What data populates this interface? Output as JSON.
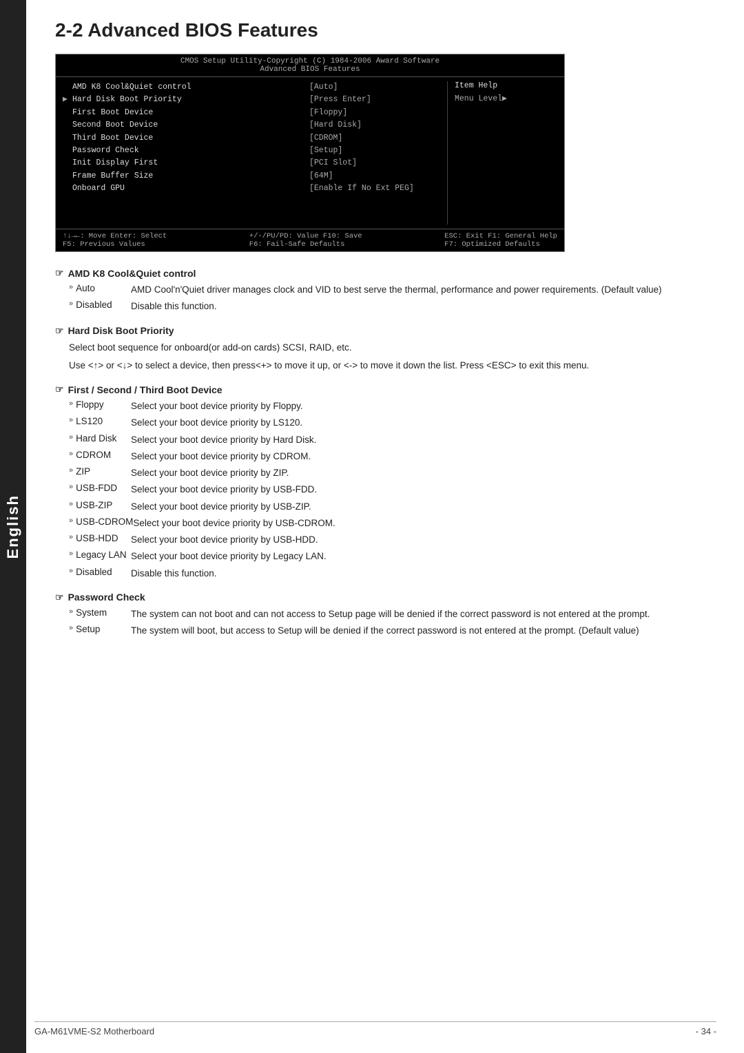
{
  "side_tab": {
    "label": "English"
  },
  "page_title": "2-2   Advanced BIOS Features",
  "bios": {
    "header_line1": "CMOS Setup Utility-Copyright (C) 1984-2006 Award Software",
    "header_line2": "Advanced BIOS Features",
    "items_left": [
      {
        "arrow": "",
        "label": "AMD K8 Cool&Quiet control",
        "selected": false
      },
      {
        "arrow": "▶",
        "label": "Hard Disk Boot Priority",
        "selected": false
      },
      {
        "arrow": "",
        "label": "First Boot Device",
        "selected": false
      },
      {
        "arrow": "",
        "label": "Second Boot Device",
        "selected": false
      },
      {
        "arrow": "",
        "label": "Third Boot Device",
        "selected": false
      },
      {
        "arrow": "",
        "label": "Password Check",
        "selected": false
      },
      {
        "arrow": "",
        "label": "Init Display First",
        "selected": false
      },
      {
        "arrow": "",
        "label": "Frame Buffer Size",
        "selected": false
      },
      {
        "arrow": "",
        "label": "Onboard GPU",
        "selected": false
      }
    ],
    "items_middle": [
      "[Auto]",
      "[Press Enter]",
      "[Floppy]",
      "[Hard Disk]",
      "[CDROM]",
      "[Setup]",
      "[PCI Slot]",
      "[64M]",
      "[Enable If No Ext PEG]"
    ],
    "item_help_title": "Item Help",
    "item_help_text": "Menu Level▶",
    "footer": {
      "line1_left": "↑↓→←: Move    Enter: Select",
      "line1_mid": "+/-/PU/PD: Value    F10: Save",
      "line1_right": "ESC: Exit    F1: General Help",
      "line2_left": "F5: Previous Values",
      "line2_mid": "F6: Fail-Safe Defaults",
      "line2_right": "F7: Optimized Defaults"
    }
  },
  "sections": [
    {
      "id": "amd-k8",
      "title": "AMD K8 Cool&Quiet control",
      "paragraphs": [],
      "items": [
        {
          "bullet": "Auto",
          "text": "AMD Cool'n'Quiet driver manages clock and VID to best serve the thermal, performance and power requirements. (Default value)"
        },
        {
          "bullet": "Disabled",
          "text": "Disable this function."
        }
      ]
    },
    {
      "id": "hard-disk-boot",
      "title": "Hard Disk Boot Priority",
      "paragraphs": [
        "Select boot sequence for onboard(or add-on cards) SCSI, RAID, etc.",
        "Use <↑> or <↓> to select a device, then press<+> to move it up, or <-> to move it down the list. Press <ESC> to exit this menu."
      ],
      "items": []
    },
    {
      "id": "boot-device",
      "title": "First / Second / Third Boot Device",
      "paragraphs": [],
      "items": [
        {
          "bullet": "Floppy",
          "text": "Select your boot device priority by Floppy."
        },
        {
          "bullet": "LS120",
          "text": "Select your boot device priority by LS120."
        },
        {
          "bullet": "Hard Disk",
          "text": "Select your boot device priority by Hard Disk."
        },
        {
          "bullet": "CDROM",
          "text": "Select your boot device priority by CDROM."
        },
        {
          "bullet": "ZIP",
          "text": "Select your boot device priority by ZIP."
        },
        {
          "bullet": "USB-FDD",
          "text": "Select your boot device priority by USB-FDD."
        },
        {
          "bullet": "USB-ZIP",
          "text": "Select your boot device priority by USB-ZIP."
        },
        {
          "bullet": "USB-CDROM",
          "text": "Select your boot device priority by USB-CDROM."
        },
        {
          "bullet": "USB-HDD",
          "text": "Select your boot device priority by USB-HDD."
        },
        {
          "bullet": "Legacy LAN",
          "text": "Select your boot device priority by Legacy LAN."
        },
        {
          "bullet": "Disabled",
          "text": "Disable this function."
        }
      ]
    },
    {
      "id": "password-check",
      "title": "Password Check",
      "paragraphs": [],
      "items": [
        {
          "bullet": "System",
          "text": "The system can not boot and can not access to Setup page will be denied if the correct password is not entered at the prompt."
        },
        {
          "bullet": "Setup",
          "text": "The system will boot, but access to Setup will be denied if the correct password is not entered at the prompt. (Default value)"
        }
      ]
    }
  ],
  "footer": {
    "left": "GA-M61VME-S2 Motherboard",
    "right": "- 34 -"
  }
}
